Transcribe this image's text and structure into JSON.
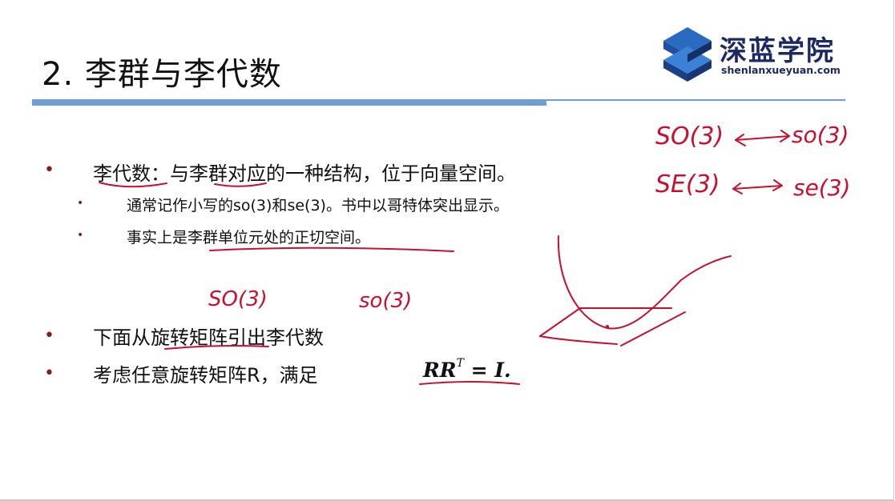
{
  "slide": {
    "title": "2. 李群与李代数"
  },
  "logo": {
    "cn": "深蓝学院",
    "en": "shenlanxueyuan.com"
  },
  "bullets": {
    "b1": "李代数：与李群对应的一种结构，位于向量空间。",
    "b1_sub1": "通常记作小写的so(3)和se(3)。书中以哥特体突出显示。",
    "b1_sub2": "事实上是李群单位元处的正切空间。",
    "b2": "下面从旋转矩阵引出李代数",
    "b3": "考虑任意旋转矩阵R，满足"
  },
  "equation": {
    "lhs": "RR",
    "sup": "T",
    "rhs": " = I."
  },
  "handwriting": {
    "top_left_1": "SO(3)",
    "top_right_1": "so(3)",
    "top_left_2": "SE(3)",
    "top_right_2": "se(3)",
    "mid_left": "SO(3)",
    "mid_right": "so(3)"
  },
  "colors": {
    "accent_bar": "#6f9fce",
    "bullet_dot": "#8b1a1a",
    "ink": "#c8102e",
    "logo": "#1c2a63"
  }
}
